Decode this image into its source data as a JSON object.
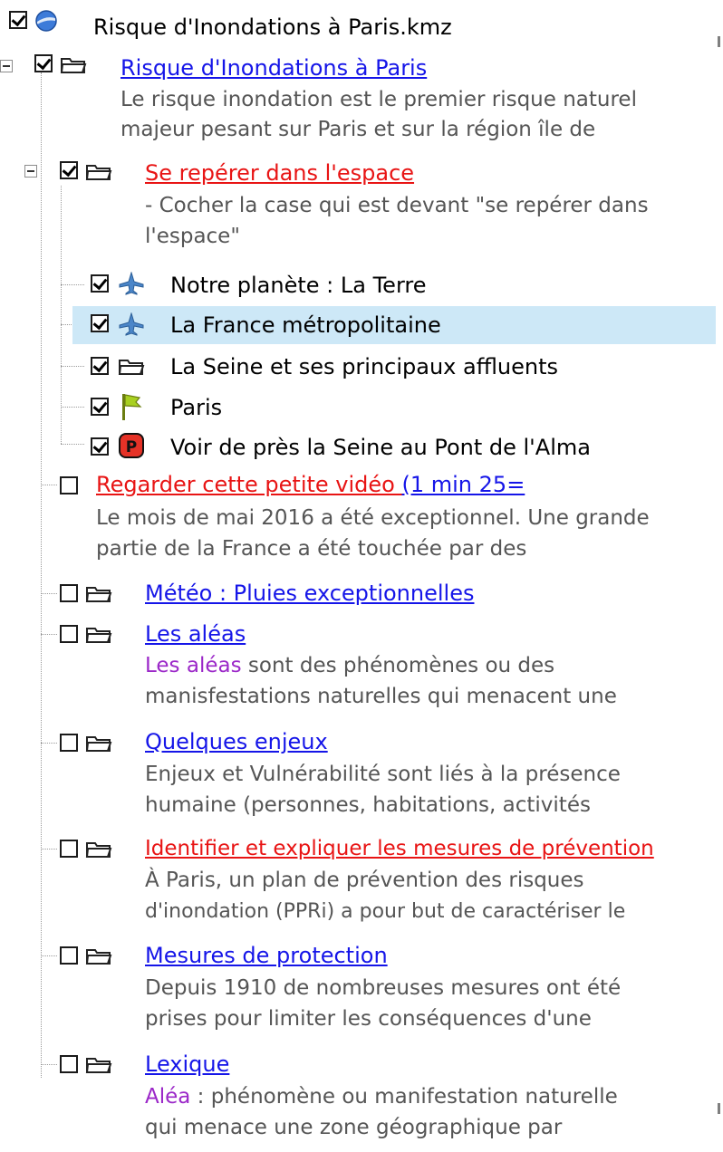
{
  "tree": {
    "root": {
      "label": "Risque d'Inondations à Paris.kmz"
    },
    "main_folder": {
      "label": "Risque d'Inondations à Paris",
      "desc": [
        "Le risque inondation est le premier risque naturel",
        "majeur pesant sur Paris et sur la région île de"
      ]
    },
    "locate_folder": {
      "label": "Se repérer dans l'espace ",
      "desc": [
        "- Cocher la case qui est devant \"se repérer dans",
        "l'espace\""
      ]
    },
    "locate_items": [
      {
        "label": "Notre planète : La Terre",
        "icon": "airplane-icon"
      },
      {
        "label": "La France métropolitaine",
        "icon": "airplane-icon"
      },
      {
        "label": "La Seine et ses principaux affluents",
        "icon": "folder-icon"
      },
      {
        "label": "Paris",
        "icon": "flag-icon"
      },
      {
        "label": "Voir de près la Seine au Pont de l'Alma",
        "icon": "parking-icon"
      }
    ],
    "video": {
      "label_red": "Regarder cette petite vidéo ",
      "label_blue": "(1 min 25=",
      "desc": [
        "Le mois de mai 2016 a été exceptionnel. Une grande",
        "partie de la France a été touchée par des"
      ]
    },
    "meteo": {
      "label": "Météo : Pluies exceptionnelles"
    },
    "aleas": {
      "label": "Les aléas",
      "desc_highlight": "Les aléas",
      "desc_rest": " sont des phénomènes ou des",
      "desc2": "manisfestations naturelles qui menacent une"
    },
    "enjeux": {
      "label": "Quelques enjeux",
      "desc": [
        "Enjeux et Vulnérabilité sont liés à la présence",
        "humaine (personnes, habitations, activités"
      ]
    },
    "prevention": {
      "label": "Identifier et expliquer les mesures de prévention",
      "desc": [
        "À Paris, un plan de prévention des risques",
        "d'inondation (PPRi) a pour but de caractériser le"
      ]
    },
    "protection": {
      "label": "Mesures de protection",
      "desc": [
        "Depuis 1910 de nombreuses mesures ont été",
        "prises pour limiter les conséquences d'une"
      ]
    },
    "lexique": {
      "label": "Lexique",
      "desc_highlight": "Aléa",
      "desc_rest": " : phénomène ou manifestation naturelle",
      "desc2": "qui menace une zone géographique par"
    }
  },
  "colors": {
    "link": "#1515e8",
    "link_red": "#e81414",
    "highlight": "#9b27c8",
    "selected_bg": "#cde8f7"
  }
}
